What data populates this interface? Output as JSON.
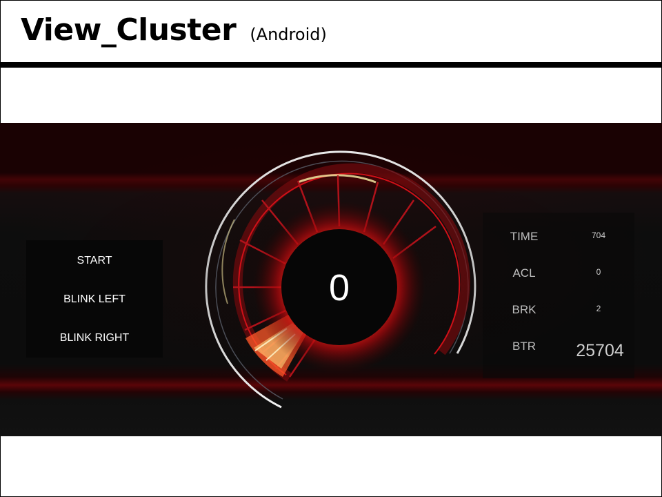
{
  "slide": {
    "title": "View_Cluster",
    "subtitle": "(Android)"
  },
  "cluster": {
    "controls": [
      "START",
      "BLINK LEFT",
      "BLINK RIGHT"
    ],
    "speed": "0",
    "stats": [
      {
        "label": "TIME",
        "value": "704"
      },
      {
        "label": "ACL",
        "value": "0"
      },
      {
        "label": "BRK",
        "value": "2"
      },
      {
        "label": "BTR",
        "value": "25704"
      }
    ],
    "colors": {
      "accent_red": "#e0101a",
      "glow_red": "#ff2a1a",
      "highlight_yellow": "#f2e6a0",
      "background": "#0c0c0c"
    }
  }
}
